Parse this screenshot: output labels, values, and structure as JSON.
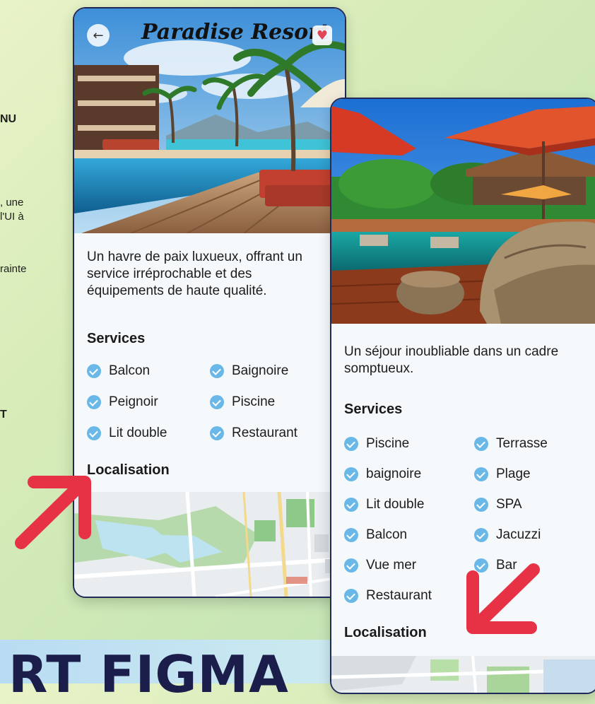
{
  "background": {
    "side_text": [
      {
        "text": "NU",
        "bold": true
      },
      {
        "text": ", une",
        "bold": false
      },
      {
        "text": "l'UI à",
        "bold": false
      },
      {
        "text": "rainte",
        "bold": false
      },
      {
        "text": "T",
        "bold": true
      }
    ],
    "big_title": "RT FIGMA"
  },
  "card1": {
    "title": "Paradise Resort",
    "back_icon": "arrow-left-icon",
    "favorite_icon": "heart-icon",
    "description": "Un havre de paix luxueux, offrant un service irréprochable et des équipements de haute qualité.",
    "services_heading": "Services",
    "services": [
      "Balcon",
      "Baignoire",
      "Peignoir",
      "Piscine",
      "Lit double",
      "Restaurant"
    ],
    "location_heading": "Localisation"
  },
  "card2": {
    "description": "Un séjour inoubliable dans un cadre somptueux.",
    "services_heading": "Services",
    "services": [
      "Piscine",
      "Terrasse",
      "baignoire",
      "Plage",
      "Lit double",
      "SPA",
      "Balcon",
      "Jacuzzi",
      "Vue mer",
      "Bar",
      "Restaurant"
    ],
    "location_heading": "Localisation"
  },
  "colors": {
    "check": "#6ab8e8",
    "arrow": "#e63244",
    "card_border": "#1f2a5a",
    "title_navy": "#1b1d4a"
  }
}
